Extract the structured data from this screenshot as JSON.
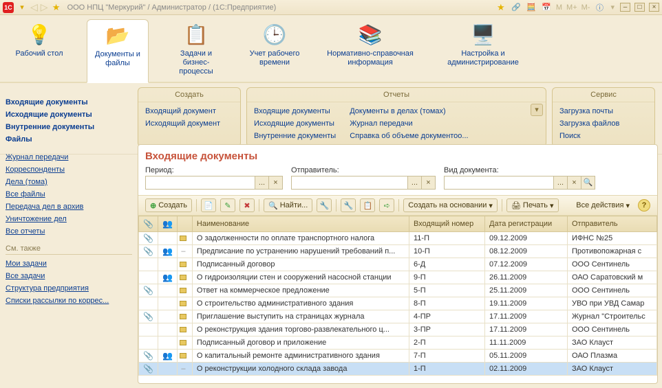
{
  "titlebar": {
    "title": "ООО НПЦ \"Меркурий\" / Администратор /  (1С:Предприятие)",
    "right_letters": [
      "М",
      "М+",
      "М-"
    ]
  },
  "sections": [
    {
      "label": "Рабочий стол",
      "icon": "💡"
    },
    {
      "label": "Документы и файлы",
      "icon": "📂",
      "active": true
    },
    {
      "label": "Задачи и бизнес-процессы",
      "icon": "📋"
    },
    {
      "label": "Учет рабочего времени",
      "icon": "🕒"
    },
    {
      "label": "Нормативно-справочная информация",
      "icon": "📚"
    },
    {
      "label": "Настройка и администрирование",
      "icon": "🖥️"
    }
  ],
  "panels": {
    "create": {
      "title": "Создать",
      "items": [
        "Входящий документ",
        "Исходящий документ"
      ]
    },
    "reports": {
      "title": "Отчеты",
      "col1": [
        "Входящие документы",
        "Исходящие документы",
        "Внутренние документы"
      ],
      "col2": [
        "Документы в делах (томах)",
        "Журнал передачи",
        "Справка об объеме документоо..."
      ]
    },
    "service": {
      "title": "Сервис",
      "items": [
        "Загрузка почты",
        "Загрузка файлов",
        "Поиск"
      ]
    }
  },
  "leftnav": {
    "primary": [
      "Входящие документы",
      "Исходящие документы",
      "Внутренние документы",
      "Файлы"
    ],
    "secondary": [
      "Журнал передачи",
      "Корреспонденты",
      "Дела (тома)",
      "Все файлы",
      "Передача дел в архив",
      "Уничтожение дел",
      "Все отчеты"
    ],
    "see_also_label": "См. также",
    "see_also": [
      "Мои задачи",
      "Все задачи",
      "Структура предприятия",
      "Списки рассылки по коррес..."
    ]
  },
  "main": {
    "heading": "Входящие документы",
    "filters": {
      "period_label": "Период:",
      "sender_label": "Отправитель:",
      "doctype_label": "Вид документа:"
    },
    "toolbar": {
      "create": "Создать",
      "find": "Найти...",
      "create_based": "Создать на основании",
      "print": "Печать",
      "all_actions": "Все действия"
    },
    "columns": {
      "name": "Наименование",
      "number": "Входящий номер",
      "date": "Дата регистрации",
      "sender": "Отправитель"
    },
    "rows": [
      {
        "clip": true,
        "ppl": false,
        "kind": "folder",
        "name": "О задолженности по оплате транспортного налога",
        "num": "11-П",
        "date": "09.12.2009",
        "sender": "ИФНС №25"
      },
      {
        "clip": true,
        "ppl": true,
        "kind": "dash",
        "name": "Предписание по устранению нарушений требований п...",
        "num": "10-П",
        "date": "08.12.2009",
        "sender": "Противопожарная с"
      },
      {
        "clip": false,
        "ppl": false,
        "kind": "folder",
        "name": "Подписанный договор",
        "num": "6-Д",
        "date": "07.12.2009",
        "sender": "ООО Сентинель"
      },
      {
        "clip": false,
        "ppl": true,
        "kind": "folder",
        "name": "О гидроизоляции стен и сооружений насосной станции",
        "num": "9-П",
        "date": "26.11.2009",
        "sender": "ОАО Саратовский м"
      },
      {
        "clip": true,
        "ppl": false,
        "kind": "folder",
        "name": "Ответ на коммерческое предложение",
        "num": "5-П",
        "date": "25.11.2009",
        "sender": "ООО Сентинель"
      },
      {
        "clip": false,
        "ppl": false,
        "kind": "folder",
        "name": "О строительство административного здания",
        "num": "8-П",
        "date": "19.11.2009",
        "sender": "УВО при УВД Самар"
      },
      {
        "clip": true,
        "ppl": false,
        "kind": "folder",
        "name": "Приглашение выступить на страницах журнала",
        "num": "4-ПР",
        "date": "17.11.2009",
        "sender": "Журнал \"Строительс"
      },
      {
        "clip": false,
        "ppl": false,
        "kind": "folder",
        "name": "О реконструкция здания торгово-развлекательного ц...",
        "num": "3-ПР",
        "date": "17.11.2009",
        "sender": "ООО Сентинель"
      },
      {
        "clip": false,
        "ppl": false,
        "kind": "folder",
        "name": "Подписанный договор и приложение",
        "num": "2-П",
        "date": "11.11.2009",
        "sender": "ЗАО Клауст"
      },
      {
        "clip": true,
        "ppl": true,
        "kind": "folder",
        "name": "О капитальный ремонте административного здания",
        "num": "7-П",
        "date": "05.11.2009",
        "sender": "ОАО Плазма"
      },
      {
        "clip": true,
        "ppl": false,
        "kind": "dash",
        "name": "О реконструкции холодного склада завода",
        "num": "1-П",
        "date": "02.11.2009",
        "sender": "ЗАО Клауст",
        "selected": true
      }
    ]
  }
}
